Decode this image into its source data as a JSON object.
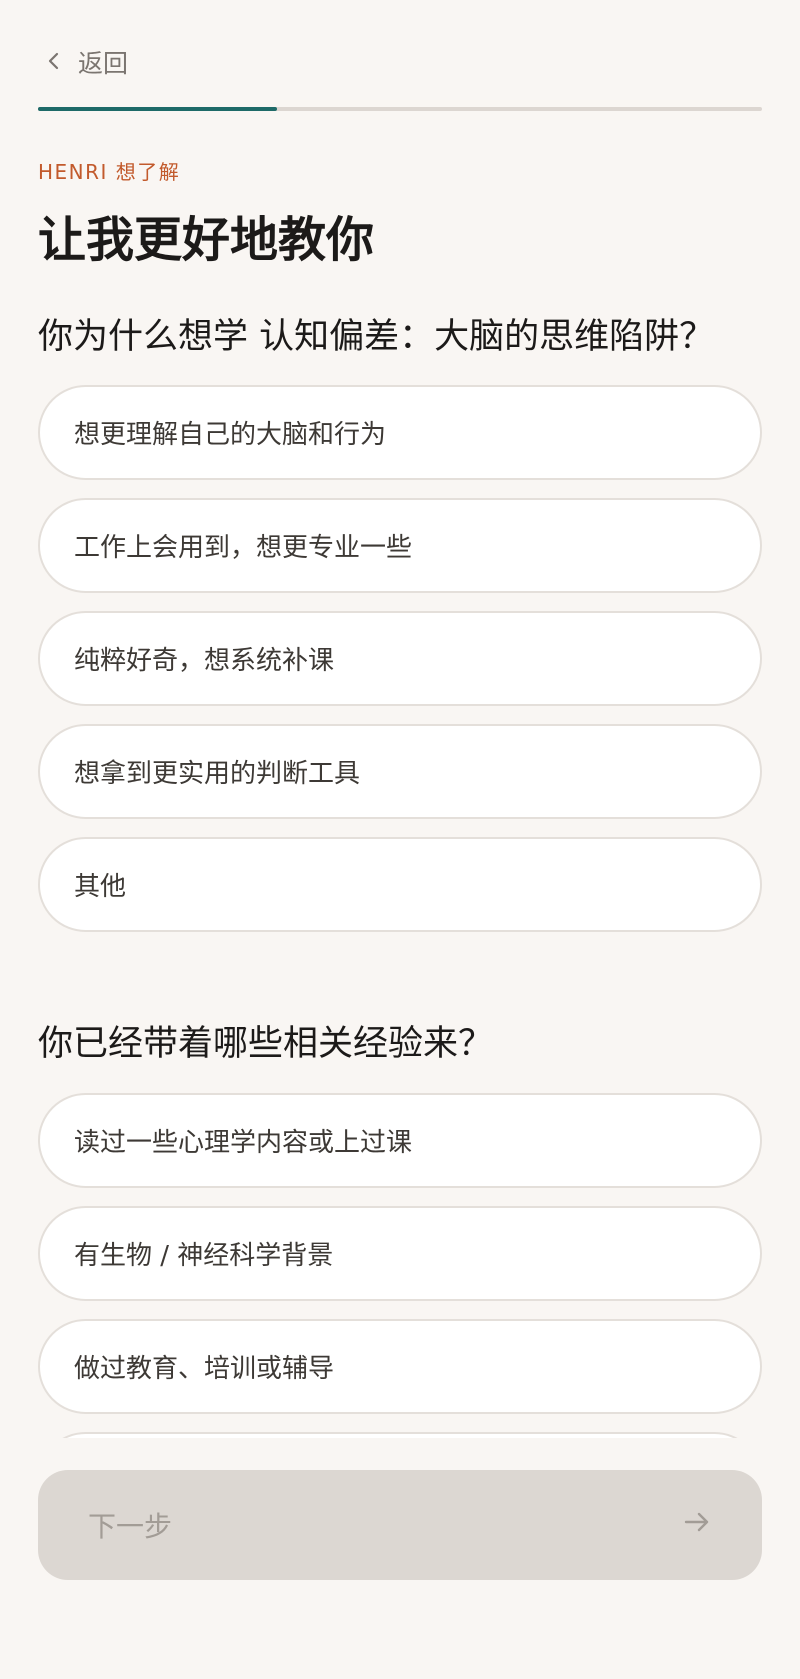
{
  "header": {
    "back_label": "返回",
    "progress": 0.33
  },
  "intro": {
    "eyebrow": "HENRI 想了解",
    "title": "让我更好地教你"
  },
  "question1": {
    "text": "你为什么想学 认知偏差：大脑的思维陷阱？",
    "options": [
      "想更理解自己的大脑和行为",
      "工作上会用到，想更专业一些",
      "纯粹好奇，想系统补课",
      "想拿到更实用的判断工具",
      "其他"
    ]
  },
  "question2": {
    "text": "你已经带着哪些相关经验来？",
    "options": [
      "读过一些心理学内容或上过课",
      "有生物 / 神经科学背景",
      "做过教育、培训或辅导"
    ]
  },
  "footer": {
    "next_label": "下一步"
  },
  "colors": {
    "accent": "#1e6a68",
    "eyebrow": "#c25a2c",
    "background": "#f9f6f3"
  }
}
